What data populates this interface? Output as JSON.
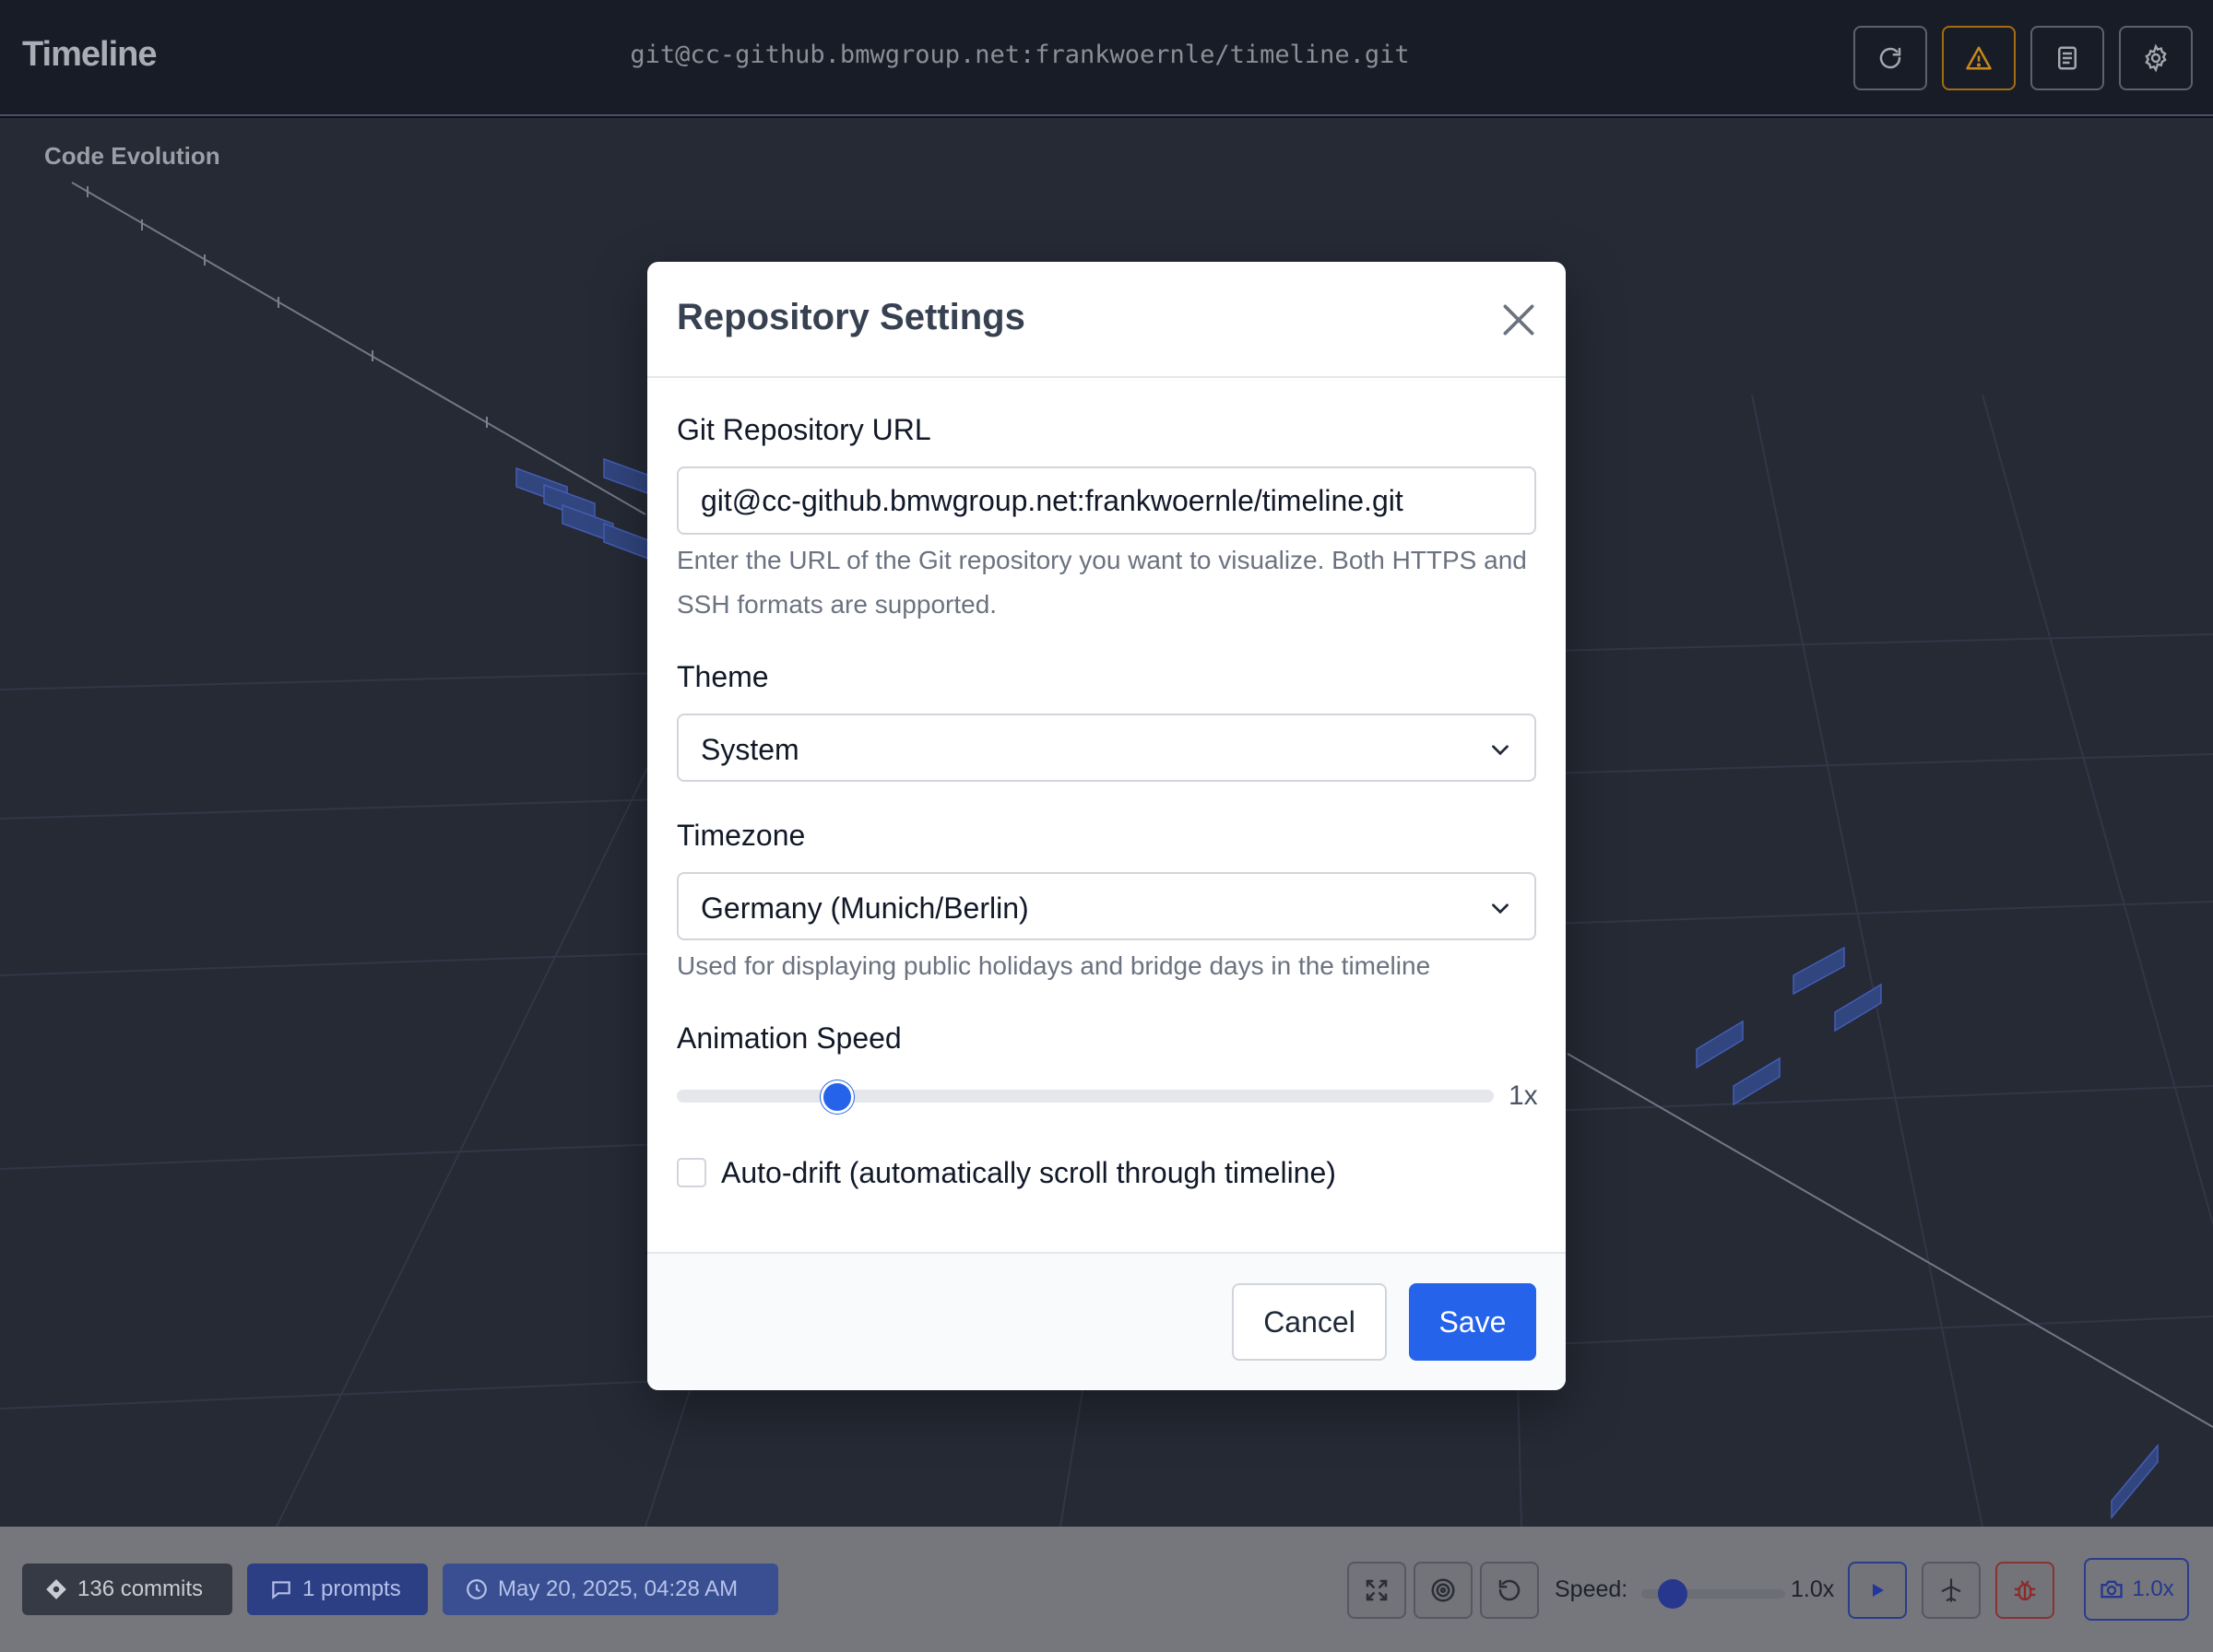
{
  "app": {
    "title": "Timeline",
    "repo_url": "git@cc-github.bmwgroup.net:frankwoernle/timeline.git"
  },
  "header_buttons": [
    {
      "icon": "refresh-icon"
    },
    {
      "icon": "warning-icon",
      "color": "#c8871c"
    },
    {
      "icon": "document-icon"
    },
    {
      "icon": "gear-icon"
    }
  ],
  "scene": {
    "title": "Code Evolution"
  },
  "modal": {
    "title": "Repository Settings",
    "url_label": "Git Repository URL",
    "url_value": "git@cc-github.bmwgroup.net:frankwoernle/timeline.git",
    "url_help": "Enter the URL of the Git repository you want to visualize. Both HTTPS and SSH formats are supported.",
    "theme_label": "Theme",
    "theme_value": "System",
    "timezone_label": "Timezone",
    "timezone_value": "Germany (Munich/Berlin)",
    "timezone_help": "Used for displaying public holidays and bridge days in the timeline",
    "speed_label": "Animation Speed",
    "speed_value": "1x",
    "speed_fraction": 0.2,
    "autodrift_label": "Auto-drift (automatically scroll through timeline)",
    "autodrift_checked": false,
    "cancel_label": "Cancel",
    "save_label": "Save",
    "accent": "#2563eb"
  },
  "footer": {
    "commits": "136 commits",
    "prompts": "1 prompts",
    "date": "May 20, 2025, 04:28 AM",
    "speed_label": "Speed:",
    "speed_value": "1.0x",
    "camera_zoom": "1.0x"
  }
}
